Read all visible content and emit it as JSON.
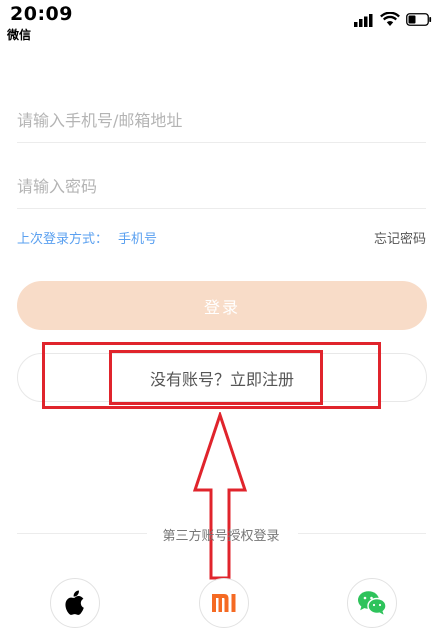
{
  "status_bar": {
    "time": "20:09",
    "app": "微信"
  },
  "form": {
    "phone_placeholder": "请输入手机号/邮箱地址",
    "password_placeholder": "请输入密码",
    "last_login_label": "上次登录方式：",
    "last_login_method": "手机号",
    "forgot_password": "忘记密码",
    "login_button": "登录",
    "register_button": "没有账号？立即注册"
  },
  "third_party": {
    "label": "第三方账号授权登录",
    "providers": [
      "apple-icon",
      "xiaomi-icon",
      "wechat-icon"
    ]
  },
  "colors": {
    "accent_link": "#5aa0f0",
    "login_button_bg": "#f8dcc8",
    "annotation_red": "#e0242c",
    "mi_orange": "#f56a23",
    "wechat_green": "#2ec35b"
  }
}
